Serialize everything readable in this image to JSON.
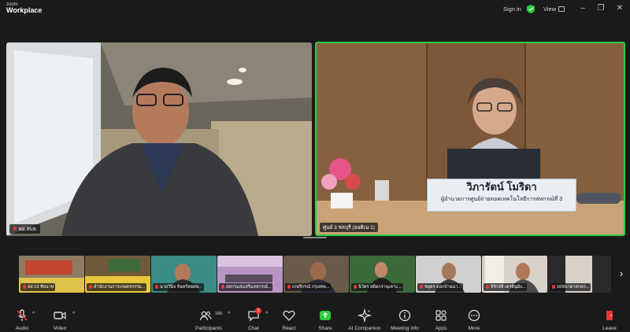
{
  "app": {
    "logo_line1": "zoom",
    "logo_line2": "Workplace",
    "sign_in": "Sign in",
    "view": "View",
    "window_controls": [
      "minimize",
      "restore",
      "close"
    ]
  },
  "main": {
    "left_tile": {
      "name": "ผอ.สบล."
    },
    "right_tile": {
      "name": "ศูนย์ 3 ชลบุรี (ออดิเน 1)",
      "placard_name": "วิภารัตน์ โมริดา",
      "placard_title": "ผู้อำนวยการศูนย์ถ่ายทอดเทคโนโลยีการสหกรณ์ที่ 3"
    }
  },
  "thumbnails": [
    {
      "name": "สส.13 ชัยนาท"
    },
    {
      "name": "สำนักงานการเกษตรกรรม..."
    },
    {
      "name": "นายวินิจ จันทร์สดดพ..."
    },
    {
      "name": "สสกรมส่งเสริมสหกรณ์..."
    },
    {
      "name": "เกษรีกรณ์ กรุงเทพ..."
    },
    {
      "name": "นิวัตร สดิดกรานุเคาะ..."
    },
    {
      "name": "ชยุตร ดอกบ้านนา..."
    },
    {
      "name": "จิรักษ์ลิ เตรสินุมัง..."
    },
    {
      "name": "10ชนาดาสกลก..."
    }
  ],
  "toolbar": {
    "audio": "Audio",
    "video": "Video",
    "participants": "Participants",
    "participants_count": "186",
    "chat": "Chat",
    "chat_badge": "1",
    "react": "React",
    "share": "Share",
    "ai_companion": "AI Companion",
    "meeting_info": "Meeting info",
    "apps": "Apps",
    "more": "More",
    "leave": "Leave"
  },
  "colors": {
    "active_speaker": "#2ecc40",
    "share_green": "#2ecc40",
    "leave_red": "#e53935",
    "background": "#1a1a1a"
  }
}
